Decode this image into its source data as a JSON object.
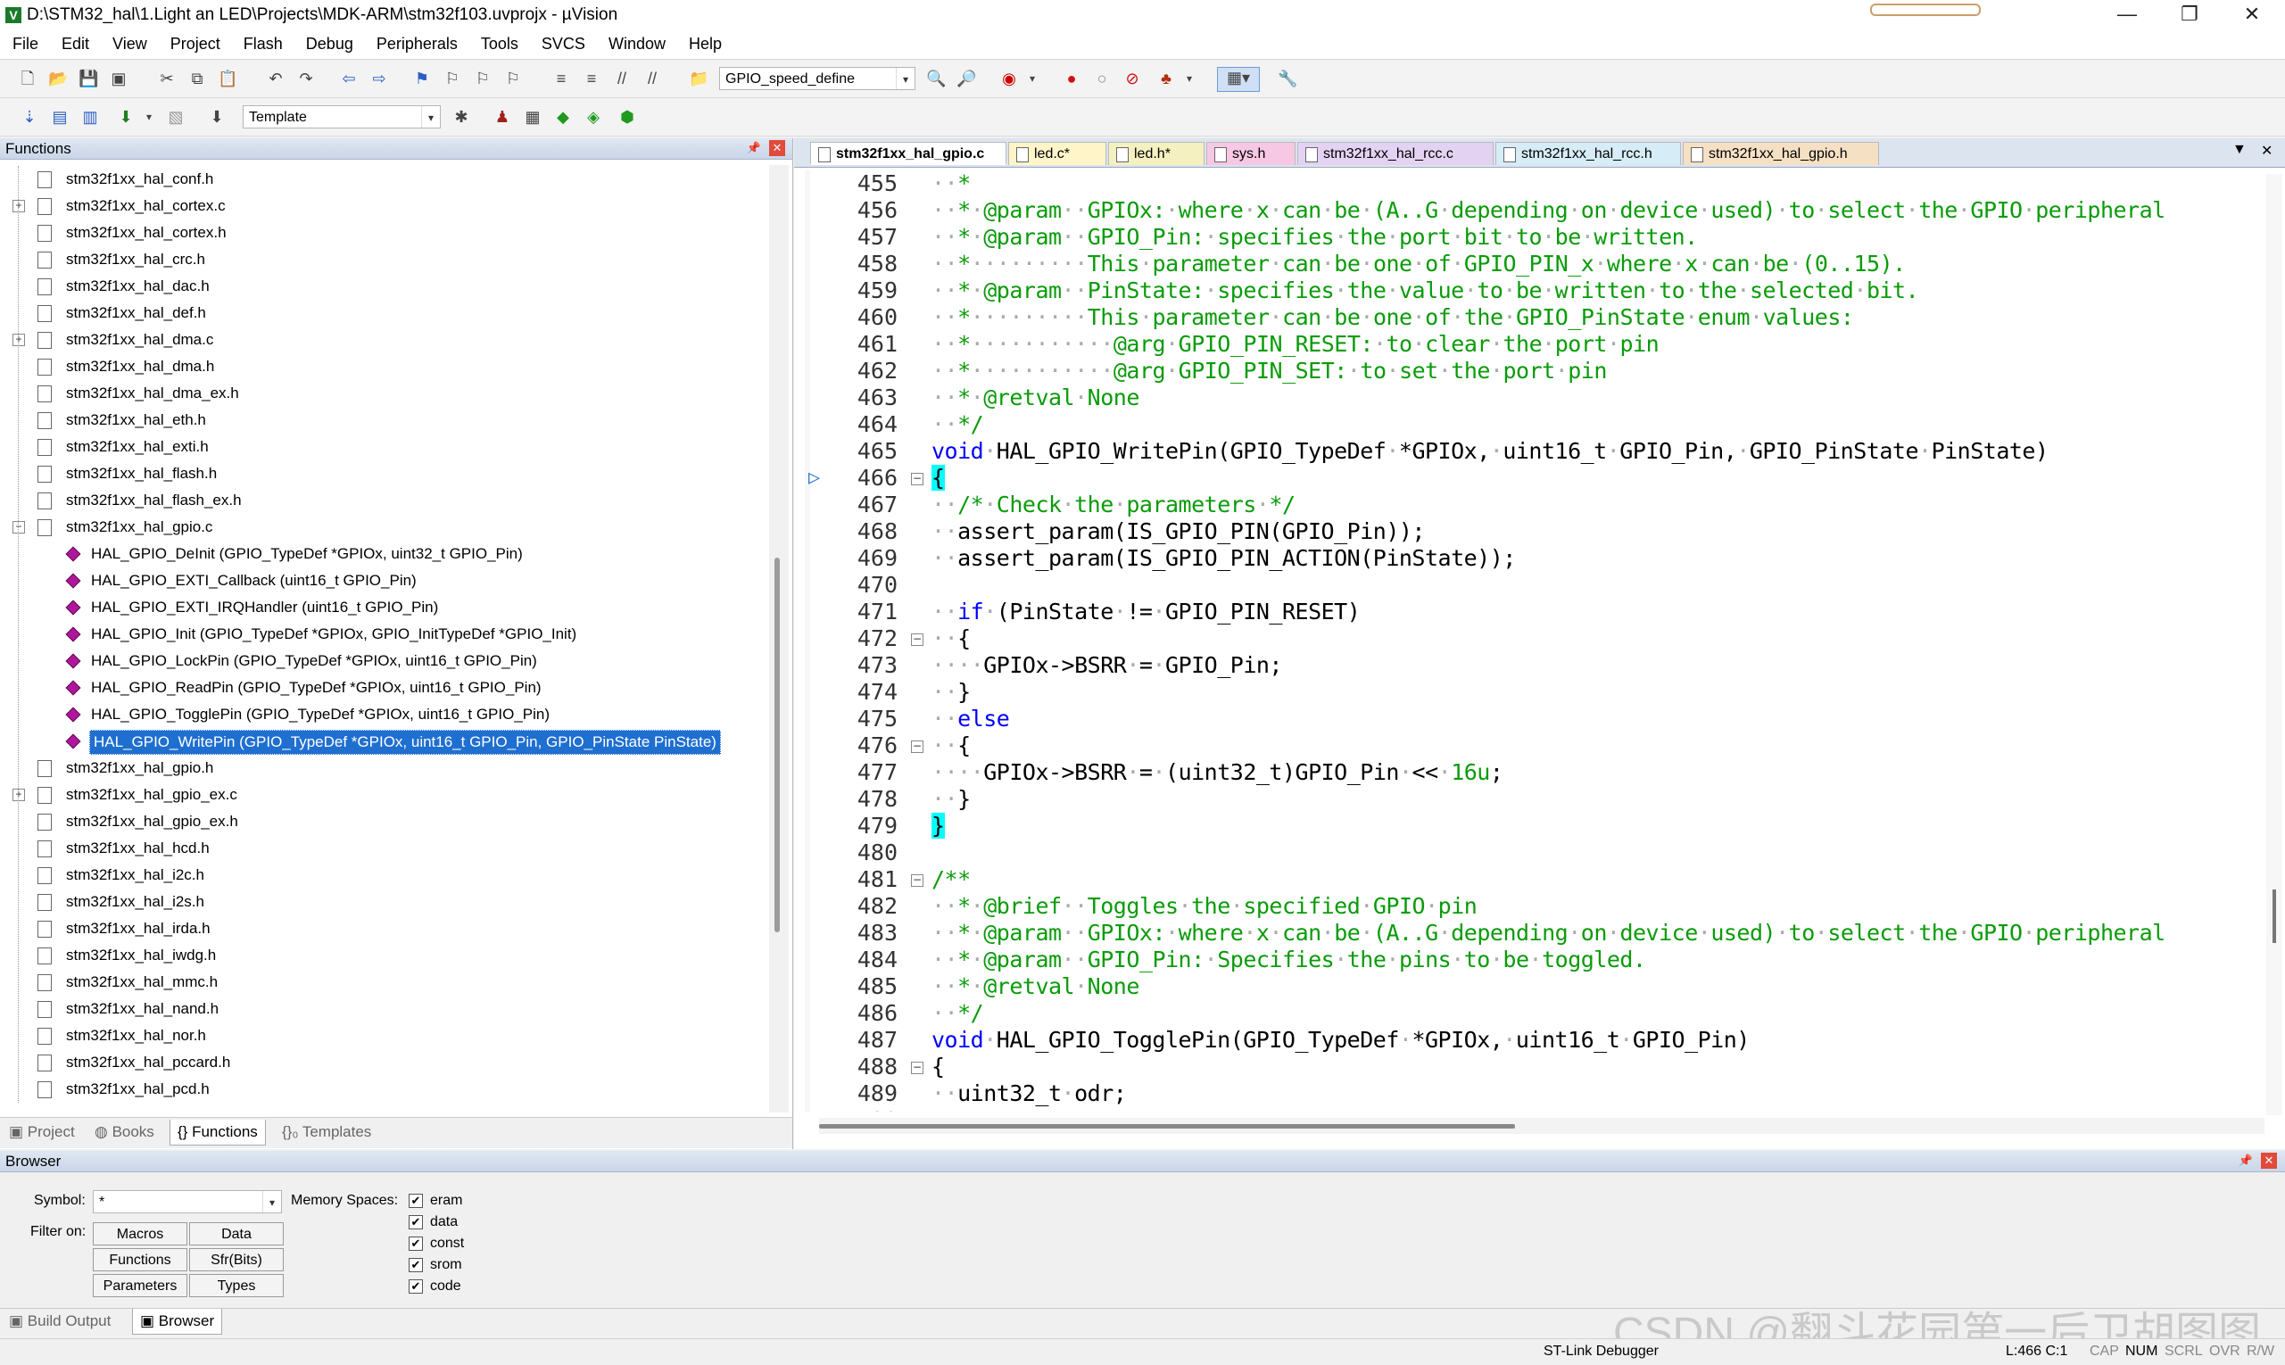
{
  "window": {
    "title": "D:\\STM32_hal\\1.Light an LED\\Projects\\MDK-ARM\\stm32f103.uvprojx - µVision",
    "minimize": "—",
    "maximize": "❐",
    "close": "✕"
  },
  "menu": [
    "File",
    "Edit",
    "View",
    "Project",
    "Flash",
    "Debug",
    "Peripherals",
    "Tools",
    "SVCS",
    "Window",
    "Help"
  ],
  "toolbar": {
    "combo_value": "GPIO_speed_define",
    "target_value": "Template"
  },
  "functions_panel": {
    "title": "Functions",
    "pin": "📌",
    "close": "✕",
    "tree": [
      {
        "label": "stm32f1xx_hal_conf.h",
        "expander": ""
      },
      {
        "label": "stm32f1xx_hal_cortex.c",
        "expander": "+"
      },
      {
        "label": "stm32f1xx_hal_cortex.h",
        "expander": ""
      },
      {
        "label": "stm32f1xx_hal_crc.h",
        "expander": ""
      },
      {
        "label": "stm32f1xx_hal_dac.h",
        "expander": ""
      },
      {
        "label": "stm32f1xx_hal_def.h",
        "expander": ""
      },
      {
        "label": "stm32f1xx_hal_dma.c",
        "expander": "+"
      },
      {
        "label": "stm32f1xx_hal_dma.h",
        "expander": ""
      },
      {
        "label": "stm32f1xx_hal_dma_ex.h",
        "expander": ""
      },
      {
        "label": "stm32f1xx_hal_eth.h",
        "expander": ""
      },
      {
        "label": "stm32f1xx_hal_exti.h",
        "expander": ""
      },
      {
        "label": "stm32f1xx_hal_flash.h",
        "expander": ""
      },
      {
        "label": "stm32f1xx_hal_flash_ex.h",
        "expander": ""
      },
      {
        "label": "stm32f1xx_hal_gpio.c",
        "expander": "−"
      }
    ],
    "functions": [
      "HAL_GPIO_DeInit (GPIO_TypeDef *GPIOx, uint32_t GPIO_Pin)",
      "HAL_GPIO_EXTI_Callback (uint16_t GPIO_Pin)",
      "HAL_GPIO_EXTI_IRQHandler (uint16_t GPIO_Pin)",
      "HAL_GPIO_Init (GPIO_TypeDef *GPIOx, GPIO_InitTypeDef *GPIO_Init)",
      "HAL_GPIO_LockPin (GPIO_TypeDef *GPIOx, uint16_t GPIO_Pin)",
      "HAL_GPIO_ReadPin (GPIO_TypeDef *GPIOx, uint16_t GPIO_Pin)",
      "HAL_GPIO_TogglePin (GPIO_TypeDef *GPIOx, uint16_t GPIO_Pin)",
      "HAL_GPIO_WritePin (GPIO_TypeDef *GPIOx, uint16_t GPIO_Pin, GPIO_PinState PinState)"
    ],
    "tree_after": [
      {
        "label": "stm32f1xx_hal_gpio.h",
        "expander": ""
      },
      {
        "label": "stm32f1xx_hal_gpio_ex.c",
        "expander": "+"
      },
      {
        "label": "stm32f1xx_hal_gpio_ex.h",
        "expander": ""
      },
      {
        "label": "stm32f1xx_hal_hcd.h",
        "expander": ""
      },
      {
        "label": "stm32f1xx_hal_i2c.h",
        "expander": ""
      },
      {
        "label": "stm32f1xx_hal_i2s.h",
        "expander": ""
      },
      {
        "label": "stm32f1xx_hal_irda.h",
        "expander": ""
      },
      {
        "label": "stm32f1xx_hal_iwdg.h",
        "expander": ""
      },
      {
        "label": "stm32f1xx_hal_mmc.h",
        "expander": ""
      },
      {
        "label": "stm32f1xx_hal_nand.h",
        "expander": ""
      },
      {
        "label": "stm32f1xx_hal_nor.h",
        "expander": ""
      },
      {
        "label": "stm32f1xx_hal_pccard.h",
        "expander": ""
      },
      {
        "label": "stm32f1xx_hal_pcd.h",
        "expander": ""
      }
    ],
    "tabs": [
      "Project",
      "Books",
      "{} Functions",
      "{}₀ Templates"
    ]
  },
  "editor": {
    "tabs": [
      {
        "label": "stm32f1xx_hal_gpio.c",
        "bg": "#ffffff"
      },
      {
        "label": "led.c*",
        "bg": "#fff5c8"
      },
      {
        "label": "led.h*",
        "bg": "#f5f0c0"
      },
      {
        "label": "sys.h",
        "bg": "#f7c8e4"
      },
      {
        "label": "stm32f1xx_hal_rcc.c",
        "bg": "#e4d2f2"
      },
      {
        "label": "stm32f1xx_hal_rcc.h",
        "bg": "#d6ecf6"
      },
      {
        "label": "stm32f1xx_hal_gpio.h",
        "bg": "#f6e0c4"
      }
    ],
    "tab_menu": "▼",
    "tab_close": "✕",
    "lines": [
      {
        "n": "455",
        "html": "<span class='cmt'>··*</span>"
      },
      {
        "n": "456",
        "html": "<span class='cmt'>··*·@param··GPIOx:·where·x·can·be·(A..G·depending·on·device·used)·to·select·the·GPIO·peripheral</span>"
      },
      {
        "n": "457",
        "html": "<span class='cmt'>··*·@param··GPIO_Pin:·specifies·the·port·bit·to·be·written.</span>"
      },
      {
        "n": "458",
        "html": "<span class='cmt'>··*·········This·parameter·can·be·one·of·GPIO_PIN_x·where·x·can·be·(0..15).</span>"
      },
      {
        "n": "459",
        "html": "<span class='cmt'>··*·@param··PinState:·specifies·the·value·to·be·written·to·the·selected·bit.</span>"
      },
      {
        "n": "460",
        "html": "<span class='cmt'>··*·········This·parameter·can·be·one·of·the·GPIO_PinState·enum·values:</span>"
      },
      {
        "n": "461",
        "html": "<span class='cmt'>··*···········@arg·GPIO_PIN_RESET:·to·clear·the·port·pin</span>"
      },
      {
        "n": "462",
        "html": "<span class='cmt'>··*···········@arg·GPIO_PIN_SET:·to·set·the·port·pin</span>"
      },
      {
        "n": "463",
        "html": "<span class='cmt'>··*·@retval·None</span>"
      },
      {
        "n": "464",
        "html": "<span class='cmt'>··*/</span>"
      },
      {
        "n": "465",
        "html": "<span class='kw'>void</span>·HAL_GPIO_WritePin(GPIO_TypeDef·*GPIOx,·uint16_t·GPIO_Pin,·GPIO_PinState·PinState)"
      },
      {
        "n": "466",
        "html": "<span class='brace-hl'>{</span>",
        "fold": "−",
        "arrow": true
      },
      {
        "n": "467",
        "html": "··<span class='cmt'>/*·Check·the·parameters·*/</span>"
      },
      {
        "n": "468",
        "html": "··assert_param(IS_GPIO_PIN(GPIO_Pin));"
      },
      {
        "n": "469",
        "html": "··assert_param(IS_GPIO_PIN_ACTION(PinState));"
      },
      {
        "n": "470",
        "html": ""
      },
      {
        "n": "471",
        "html": "··<span class='kw'>if</span>·(PinState·!=·GPIO_PIN_RESET)"
      },
      {
        "n": "472",
        "html": "··{",
        "fold": "−"
      },
      {
        "n": "473",
        "html": "····GPIOx->BSRR·=·GPIO_Pin;"
      },
      {
        "n": "474",
        "html": "··}"
      },
      {
        "n": "475",
        "html": "··<span class='kw'>else</span>"
      },
      {
        "n": "476",
        "html": "··{",
        "fold": "−"
      },
      {
        "n": "477",
        "html": "····GPIOx->BSRR·=·(uint32_t)GPIO_Pin·<<·<span class='num'>16u</span>;"
      },
      {
        "n": "478",
        "html": "··}"
      },
      {
        "n": "479",
        "html": "<span class='brace-hl'>}</span>"
      },
      {
        "n": "480",
        "html": ""
      },
      {
        "n": "481",
        "html": "<span class='cmt'>/**</span>",
        "fold": "−"
      },
      {
        "n": "482",
        "html": "<span class='cmt'>··*·@brief··Toggles·the·specified·GPIO·pin</span>"
      },
      {
        "n": "483",
        "html": "<span class='cmt'>··*·@param··GPIOx:·where·x·can·be·(A..G·depending·on·device·used)·to·select·the·GPIO·peripheral</span>"
      },
      {
        "n": "484",
        "html": "<span class='cmt'>··*·@param··GPIO_Pin:·Specifies·the·pins·to·be·toggled.</span>"
      },
      {
        "n": "485",
        "html": "<span class='cmt'>··*·@retval·None</span>"
      },
      {
        "n": "486",
        "html": "<span class='cmt'>··*/</span>"
      },
      {
        "n": "487",
        "html": "<span class='kw'>void</span>·HAL_GPIO_TogglePin(GPIO_TypeDef·*GPIOx,·uint16_t·GPIO_Pin)"
      },
      {
        "n": "488",
        "html": "{",
        "fold": "−"
      },
      {
        "n": "489",
        "html": "··uint32_t·odr;"
      },
      {
        "n": "490",
        "html": ""
      }
    ]
  },
  "browser": {
    "title": "Browser",
    "symbol_label": "Symbol:",
    "symbol_value": "*",
    "filter_label": "Filter on:",
    "memory_label": "Memory Spaces:",
    "filters": [
      "Macros",
      "Data",
      "Functions",
      "Sfr(Bits)",
      "Parameters",
      "Types"
    ],
    "memory_spaces": [
      "eram",
      "data",
      "const",
      "srom",
      "code"
    ]
  },
  "bottom_tabs": [
    "Build Output",
    "Browser"
  ],
  "status": {
    "debugger": "ST-Link Debugger",
    "position": "L:466 C:1",
    "flags": [
      "CAP",
      "NUM",
      "SCRL",
      "OVR",
      "R/W"
    ]
  },
  "watermark": "CSDN @翻斗花园第一后卫胡图图"
}
